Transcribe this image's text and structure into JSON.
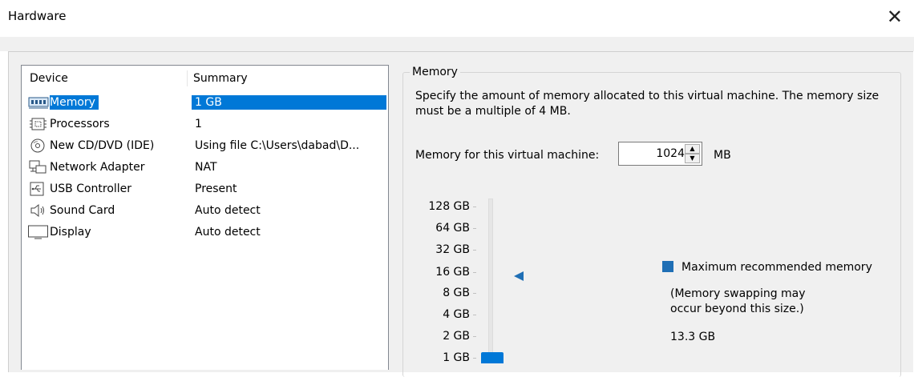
{
  "window": {
    "title": "Hardware"
  },
  "device_list": {
    "columns": [
      "Device",
      "Summary"
    ],
    "rows": [
      {
        "icon": "memory-icon",
        "device": "Memory",
        "summary": "1 GB",
        "selected": true
      },
      {
        "icon": "processor-icon",
        "device": "Processors",
        "summary": "1",
        "selected": false
      },
      {
        "icon": "cd-dvd-icon",
        "device": "New CD/DVD (IDE)",
        "summary": "Using file C:\\Users\\dabad\\D...",
        "selected": false
      },
      {
        "icon": "network-adapter-icon",
        "device": "Network Adapter",
        "summary": "NAT",
        "selected": false
      },
      {
        "icon": "usb-icon",
        "device": "USB Controller",
        "summary": "Present",
        "selected": false
      },
      {
        "icon": "speaker-icon",
        "device": "Sound Card",
        "summary": "Auto detect",
        "selected": false
      },
      {
        "icon": "display-icon",
        "device": "Display",
        "summary": "Auto detect",
        "selected": false
      }
    ]
  },
  "memory_panel": {
    "group_title": "Memory",
    "description": "Specify the amount of memory allocated to this virtual machine. The memory size must be a multiple of 4 MB.",
    "field_label": "Memory for this virtual machine:",
    "value": "1024",
    "unit": "MB",
    "scale_labels": [
      "128 GB",
      "64 GB",
      "32 GB",
      "16 GB",
      "8 GB",
      "4 GB",
      "2 GB",
      "1 GB"
    ],
    "legend_label": "Maximum recommended memory",
    "note_line1": "(Memory swapping may",
    "note_line2": "occur beyond this size.)",
    "recommended_value": "13.3 GB"
  },
  "colors": {
    "selection": "#0078d7",
    "marker": "#1f6fb5"
  }
}
